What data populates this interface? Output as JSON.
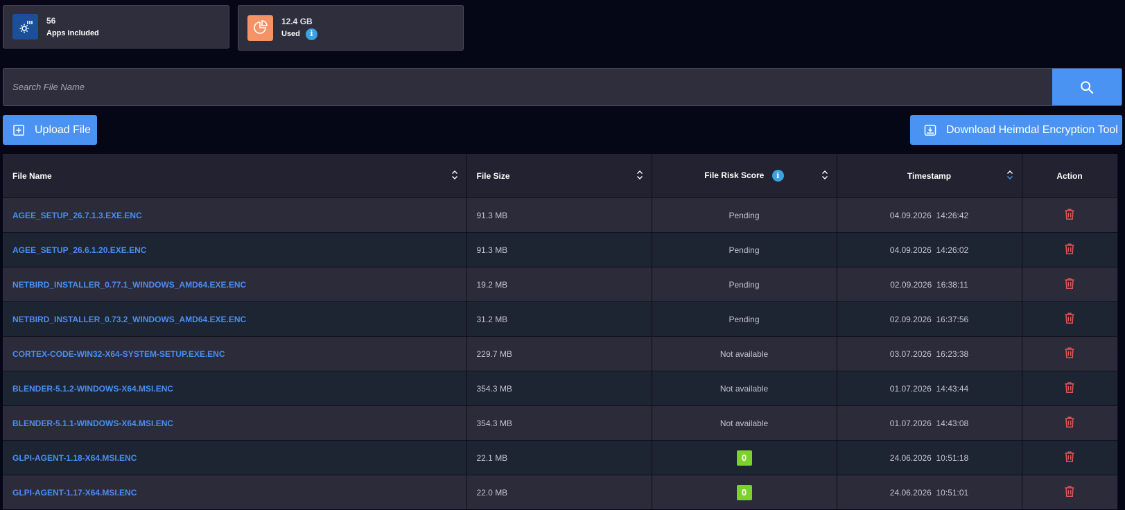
{
  "stats": {
    "apps": {
      "value": "56",
      "label": "Apps Included",
      "icon": "gear-icon"
    },
    "storage": {
      "value": "12.4 GB",
      "label": "Used",
      "icon": "pie-chart-icon"
    }
  },
  "search": {
    "placeholder": "Search File Name",
    "value": ""
  },
  "actions": {
    "upload_label": "Upload File",
    "download_label": "Download Heimdal Encryption Tool"
  },
  "table": {
    "columns": {
      "file_name": "File Name",
      "file_size": "File Size",
      "risk_score": "File Risk Score",
      "timestamp": "Timestamp",
      "action": "Action"
    },
    "rows": [
      {
        "name": "AGEE_SETUP_26.7.1.3.EXE.ENC",
        "size": "91.3 MB",
        "risk": "Pending",
        "timestamp": "04.09.2026  14:26:42"
      },
      {
        "name": "AGEE_SETUP_26.6.1.20.EXE.ENC",
        "size": "91.3 MB",
        "risk": "Pending",
        "timestamp": "04.09.2026  14:26:02"
      },
      {
        "name": "NETBIRD_INSTALLER_0.77.1_WINDOWS_AMD64.EXE.ENC",
        "size": "19.2 MB",
        "risk": "Pending",
        "timestamp": "02.09.2026  16:38:11"
      },
      {
        "name": "NETBIRD_INSTALLER_0.73.2_WINDOWS_AMD64.EXE.ENC",
        "size": "31.2 MB",
        "risk": "Pending",
        "timestamp": "02.09.2026  16:37:56"
      },
      {
        "name": "CORTEX-CODE-WIN32-X64-SYSTEM-SETUP.EXE.ENC",
        "size": "229.7 MB",
        "risk": "Not available",
        "timestamp": "03.07.2026  16:23:38"
      },
      {
        "name": "BLENDER-5.1.2-WINDOWS-X64.MSI.ENC",
        "size": "354.3 MB",
        "risk": "Not available",
        "timestamp": "01.07.2026  14:43:44"
      },
      {
        "name": "BLENDER-5.1.1-WINDOWS-X64.MSI.ENC",
        "size": "354.3 MB",
        "risk": "Not available",
        "timestamp": "01.07.2026  14:43:08"
      },
      {
        "name": "GLPI-AGENT-1.18-X64.MSI.ENC",
        "size": "22.1 MB",
        "risk": "0",
        "risk_badge": true,
        "timestamp": "24.06.2026  10:51:18"
      },
      {
        "name": "GLPI-AGENT-1.17-X64.MSI.ENC",
        "size": "22.0 MB",
        "risk": "0",
        "risk_badge": true,
        "timestamp": "24.06.2026  10:51:01"
      }
    ]
  },
  "colors": {
    "accent": "#4b93f2",
    "link": "#4b8ef0",
    "danger": "#e05555",
    "badge_green": "#7bd229",
    "info": "#3aa3e3"
  }
}
